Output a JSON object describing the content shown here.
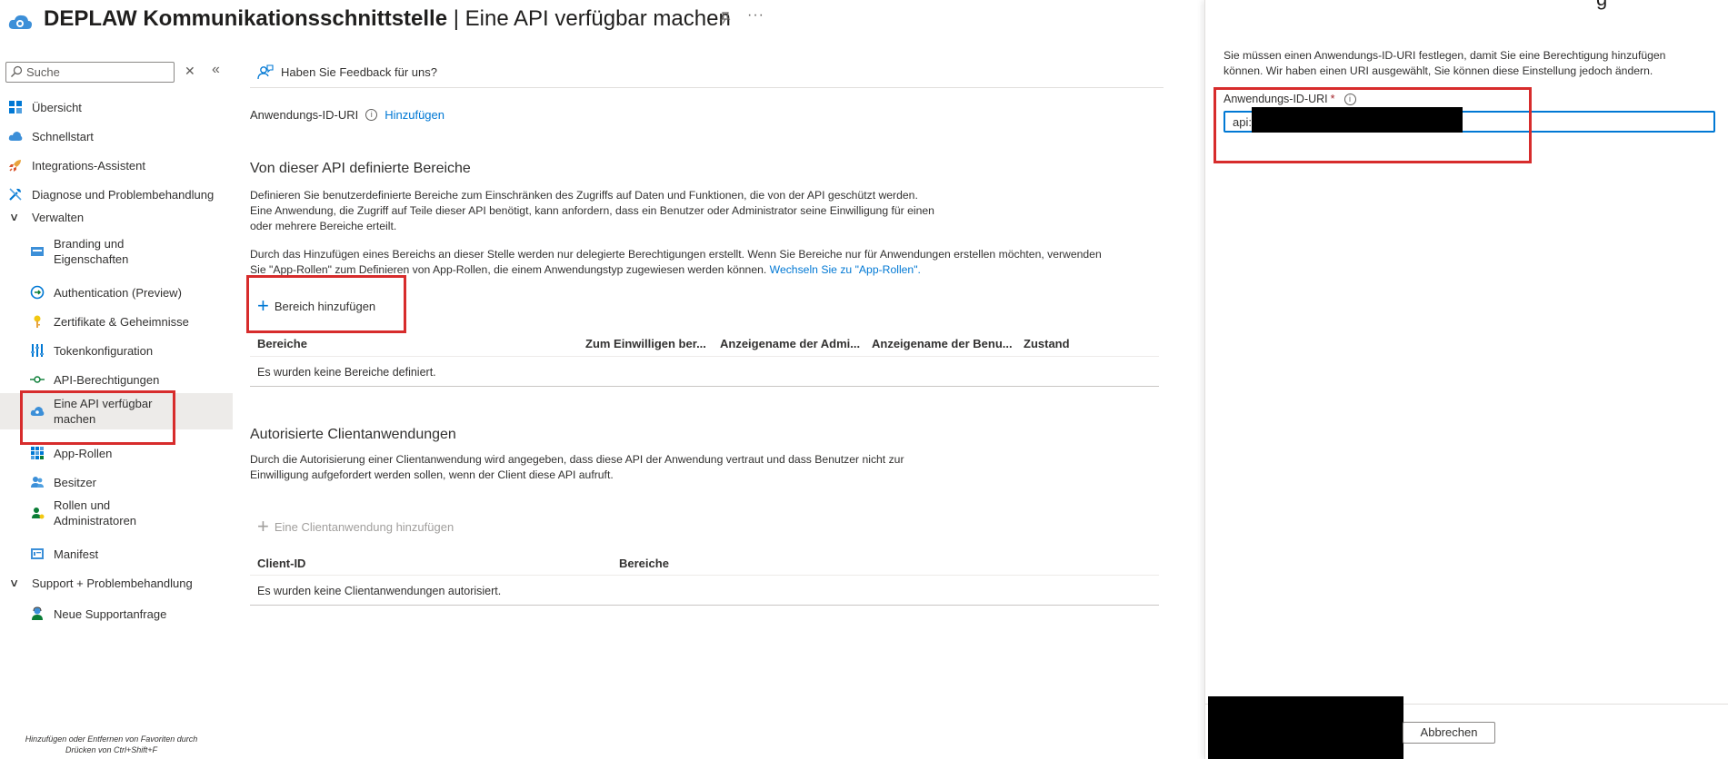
{
  "header": {
    "title_bold": "DEPLAW Kommunikationsschnittstelle",
    "title_rest": " | Eine API verfügbar machen",
    "more": "···"
  },
  "sidebar": {
    "search_placeholder": "Suche",
    "close_glyph": "✕",
    "collapse_glyph": "«",
    "items": [
      {
        "label": "Übersicht",
        "icon": "overview-grid-icon"
      },
      {
        "label": "Schnellstart",
        "icon": "quickstart-cloud-icon"
      },
      {
        "label": "Integrations-Assistent",
        "icon": "rocket-icon"
      },
      {
        "label": "Diagnose und Problembehandlung",
        "icon": "wrench-icon"
      },
      {
        "label": "Verwalten",
        "icon": "chevron-down-icon"
      },
      {
        "label": "Branding und Eigenschaften",
        "icon": "branding-icon"
      },
      {
        "label": "Authentication (Preview)",
        "icon": "authentication-icon"
      },
      {
        "label": "Zertifikate & Geheimnisse",
        "icon": "key-icon"
      },
      {
        "label": "Tokenkonfiguration",
        "icon": "token-bars-icon"
      },
      {
        "label": "API-Berechtigungen",
        "icon": "api-permission-icon"
      },
      {
        "label": "Eine API verfügbar machen",
        "icon": "expose-api-cloud-icon"
      },
      {
        "label": "App-Rollen",
        "icon": "app-roles-grid-icon"
      },
      {
        "label": "Besitzer",
        "icon": "owners-icon"
      },
      {
        "label": "Rollen und Administratoren",
        "icon": "roles-admins-icon"
      },
      {
        "label": "Manifest",
        "icon": "manifest-icon"
      },
      {
        "label": "Support + Problembehandlung",
        "icon": "chevron-down-icon"
      },
      {
        "label": "Neue Supportanfrage",
        "icon": "support-person-icon"
      }
    ],
    "favorites_hint_line1": "Hinzufügen oder Entfernen von Favoriten durch",
    "favorites_hint_line2": "Drücken von Ctrl+Shift+F"
  },
  "main": {
    "feedback": "Haben Sie Feedback für uns?",
    "uri_label": "Anwendungs-ID-URI",
    "uri_add_link": "Hinzufügen",
    "scopes_title": "Von dieser API definierte Bereiche",
    "scopes_para1_l1": "Definieren Sie benutzerdefinierte Bereiche zum Einschränken des Zugriffs auf Daten und Funktionen, die von der API geschützt werden.",
    "scopes_para1_l2": "Eine Anwendung, die Zugriff auf Teile dieser API benötigt, kann anfordern, dass ein Benutzer oder Administrator seine Einwilligung für einen",
    "scopes_para1_l3": "oder mehrere Bereiche erteilt.",
    "scopes_para2_l1": "Durch das Hinzufügen eines Bereichs an dieser Stelle werden nur delegierte Berechtigungen erstellt. Wenn Sie Bereiche nur für Anwendungen erstellen möchten, verwenden",
    "scopes_para2_l2": "Sie \"App-Rollen\" zum Definieren von App-Rollen, die einem Anwendungstyp zugewiesen werden können.",
    "scopes_para2_link": "Wechseln Sie zu \"App-Rollen\".",
    "add_scope": "Bereich hinzufügen",
    "scopes_columns": [
      "Bereiche",
      "Zum Einwilligen ber...",
      "Anzeigename der Admi...",
      "Anzeigename der Benu...",
      "Zustand"
    ],
    "scopes_empty": "Es wurden keine Bereiche definiert.",
    "clients_title": "Autorisierte Clientanwendungen",
    "clients_para_l1": "Durch die Autorisierung einer Clientanwendung wird angegeben, dass diese API der Anwendung vertraut und dass Benutzer nicht zur",
    "clients_para_l2": "Einwilligung aufgefordert werden sollen, wenn der Client diese API aufruft.",
    "add_client": "Eine Clientanwendung hinzufügen",
    "clients_columns": [
      "Client-ID",
      "Bereiche"
    ],
    "clients_empty": "Es wurden keine Clientanwendungen autorisiert."
  },
  "panel": {
    "title_fragment": "g",
    "desc_l1": "Sie müssen einen Anwendungs-ID-URI festlegen, damit Sie eine Berechtigung hinzufügen",
    "desc_l2": "können. Wir haben einen URI ausgewählt, Sie können diese Einstellung jedoch ändern.",
    "field_label": "Anwendungs-ID-URI",
    "required_mark": "*",
    "field_value": "api:/",
    "cancel": "Abbrechen"
  },
  "colors": {
    "accent": "#0078d4",
    "highlight_box": "#d72c2c",
    "selected_bg": "#edebe9"
  }
}
